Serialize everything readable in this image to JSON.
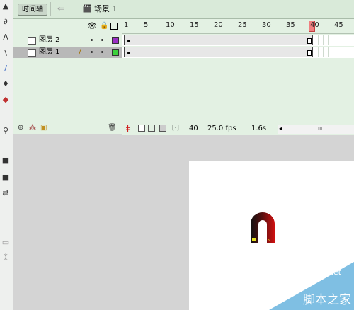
{
  "toolbar": {
    "timeline_label": "时间轴",
    "scene_label": "场景 1"
  },
  "layers": [
    {
      "name": "图层 2",
      "color": "#9a2fc4",
      "selected": false
    },
    {
      "name": "图层 1",
      "color": "#3bd13b",
      "selected": true
    }
  ],
  "ruler": {
    "labels": [
      "1",
      "5",
      "10",
      "15",
      "20",
      "25",
      "30",
      "35",
      "40",
      "45"
    ]
  },
  "status": {
    "current_frame": "40",
    "frame_rate": "25.0 fps",
    "elapsed": "1.6s",
    "scroll_glyph": "III"
  },
  "watermark": {
    "site": "jb51.net",
    "text": "脚本之家"
  }
}
